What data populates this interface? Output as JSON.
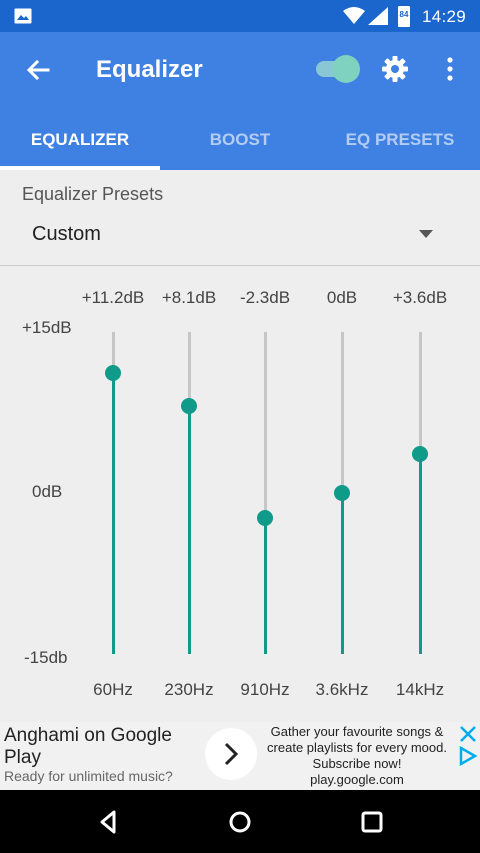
{
  "status_bar": {
    "time": "14:29",
    "battery": "84",
    "icons": [
      "image-icon",
      "wifi-icon",
      "signal-icon",
      "battery-icon"
    ]
  },
  "app_bar": {
    "title": "Equalizer",
    "toggle_on": true,
    "colors": {
      "app_bar": "#3f80e3",
      "status_bar": "#1a66cc",
      "accent": "#109a8a"
    }
  },
  "tabs": [
    {
      "label": "EQUALIZER",
      "active": true
    },
    {
      "label": "BOOST",
      "active": false
    },
    {
      "label": "EQ PRESETS",
      "active": false
    }
  ],
  "presets": {
    "label": "Equalizer Presets",
    "value": "Custom"
  },
  "equalizer": {
    "axis": {
      "max_label": "+15dB",
      "mid_label": "0dB",
      "min_label": "-15db",
      "max": 15,
      "min": -15
    },
    "bands": [
      {
        "freq": "60Hz",
        "gain_label": "+11.2dB",
        "gain": 11.2
      },
      {
        "freq": "230Hz",
        "gain_label": "+8.1dB",
        "gain": 8.1
      },
      {
        "freq": "910Hz",
        "gain_label": "-2.3dB",
        "gain": -2.3
      },
      {
        "freq": "3.6kHz",
        "gain_label": "0dB",
        "gain": 0
      },
      {
        "freq": "14kHz",
        "gain_label": "+3.6dB",
        "gain": 3.6
      }
    ]
  },
  "ad": {
    "title": "Anghami on Google Play",
    "subtitle": "Ready for unlimited music?",
    "text": "Gather your favourite songs & create playlists for every mood. Subscribe now!",
    "url": "play.google.com"
  }
}
